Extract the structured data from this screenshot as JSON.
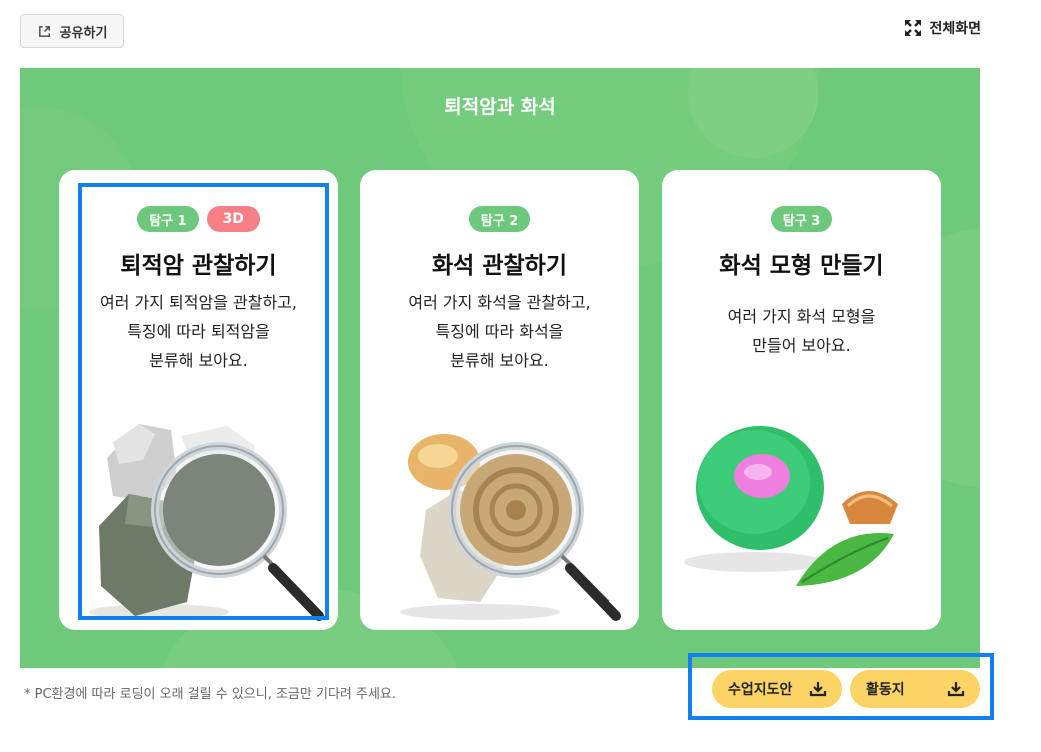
{
  "toolbar": {
    "share_label": "공유하기",
    "fullscreen_label": "전체화면"
  },
  "stage": {
    "title": "퇴적암과 화석",
    "bg_color": "#6fc97a"
  },
  "cards": [
    {
      "badge": "탐구 1",
      "badge_extra": "3D",
      "title": "퇴적암 관찰하기",
      "desc": [
        "여러 가지 퇴적암을 관찰하고,",
        "특징에 따라 퇴적암을",
        "분류해 보아요."
      ],
      "image_alt": "sedimentary rocks under magnifying glass"
    },
    {
      "badge": "탐구 2",
      "title": "화석 관찰하기",
      "desc": [
        "여러 가지 화석을 관찰하고,",
        "특징에 따라 화석을",
        "분류해 보아요."
      ],
      "image_alt": "ammonite fossil under magnifying glass"
    },
    {
      "badge": "탐구 3",
      "title": "화석 모형 만들기",
      "desc": [
        "여러 가지 화석 모형을",
        "만들어 보아요."
      ],
      "image_alt": "clay fossil model with shell and leaf"
    }
  ],
  "footer": {
    "note": "* PC환경에 따라 로딩이 오래 걸릴 수 있으니, 조금만 기다려 주세요.",
    "guide_label": "수업지도안",
    "activity_label": "활동지"
  },
  "colors": {
    "accent_green": "#6cc97c",
    "badge_3d": "#f77f86",
    "download_button": "#fcd465",
    "highlight": "#1280ee"
  },
  "icons": [
    "share-icon",
    "fullscreen-icon",
    "download-icon"
  ]
}
